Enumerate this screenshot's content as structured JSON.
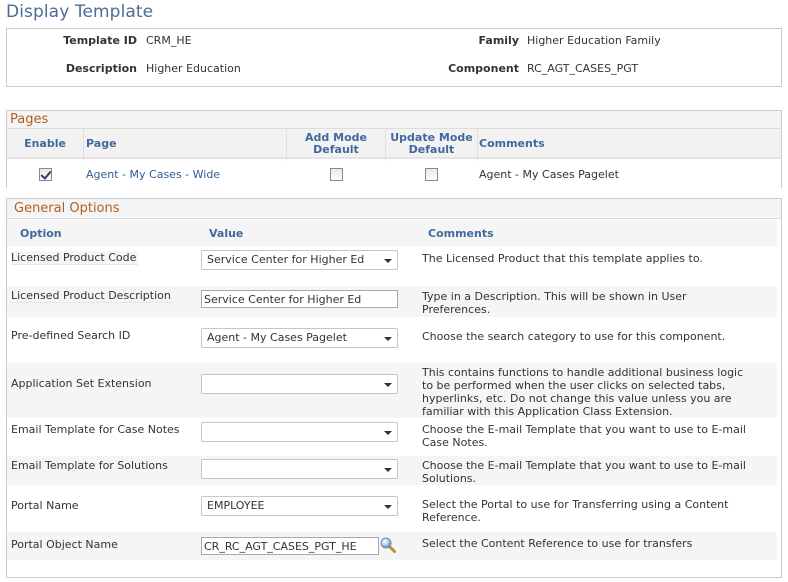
{
  "page": {
    "title": "Display Template"
  },
  "header": {
    "template_id_label": "Template ID",
    "template_id_value": "CRM_HE",
    "description_label": "Description",
    "description_value": "Higher Education",
    "family_label": "Family",
    "family_value": "Higher Education Family",
    "component_label": "Component",
    "component_value": "RC_AGT_CASES_PGT"
  },
  "pages_grid": {
    "title": "Pages",
    "columns": {
      "enable": "Enable",
      "page": "Page",
      "add_mode_line1": "Add Mode",
      "add_mode_line2": "Default",
      "update_mode_line1": "Update Mode",
      "update_mode_line2": "Default",
      "comments": "Comments"
    },
    "rows": [
      {
        "enabled": true,
        "page": "Agent - My Cases - Wide",
        "add_mode_default": false,
        "update_mode_default": false,
        "comments": "Agent - My Cases Pagelet"
      }
    ]
  },
  "general_options": {
    "title": "General Options",
    "columns": {
      "option": "Option",
      "value": "Value",
      "comments": "Comments"
    },
    "rows": [
      {
        "option": "Licensed Product Code",
        "control": "select",
        "value": "Service Center for Higher Ed",
        "comment": "The Licensed Product that this template applies to."
      },
      {
        "option": "Licensed Product Description",
        "control": "text",
        "value": "Service Center for Higher Ed",
        "comment": "Type in a Description. This will be shown in User Preferences."
      },
      {
        "option": "Pre-defined Search ID",
        "control": "select",
        "value": "Agent - My Cases Pagelet",
        "comment": "Choose the search category to use for this component."
      },
      {
        "option": "Application Set Extension",
        "control": "select",
        "value": "",
        "comment": "This contains functions to handle additional business logic to be performed when the user clicks on selected tabs, hyperlinks, etc. Do not change this value unless you are familiar with this Application Class Extension."
      },
      {
        "option": "Email Template for Case Notes",
        "control": "select",
        "value": "",
        "comment": "Choose the E-mail Template that you want to use to E-mail Case Notes."
      },
      {
        "option": "Email Template for Solutions",
        "control": "select",
        "value": "",
        "comment": "Choose the E-mail Template that you want to use to E-mail Solutions."
      },
      {
        "option": "Portal Name",
        "control": "select",
        "value": "EMPLOYEE",
        "comment": "Select the Portal to use for Transferring using a Content Reference."
      },
      {
        "option": "Portal Object Name",
        "control": "text-lookup",
        "value": "CR_RC_AGT_CASES_PGT_HE",
        "comment": "Select the Content Reference to use for transfers",
        "icon": "lookup-magnifier-icon"
      }
    ]
  }
}
